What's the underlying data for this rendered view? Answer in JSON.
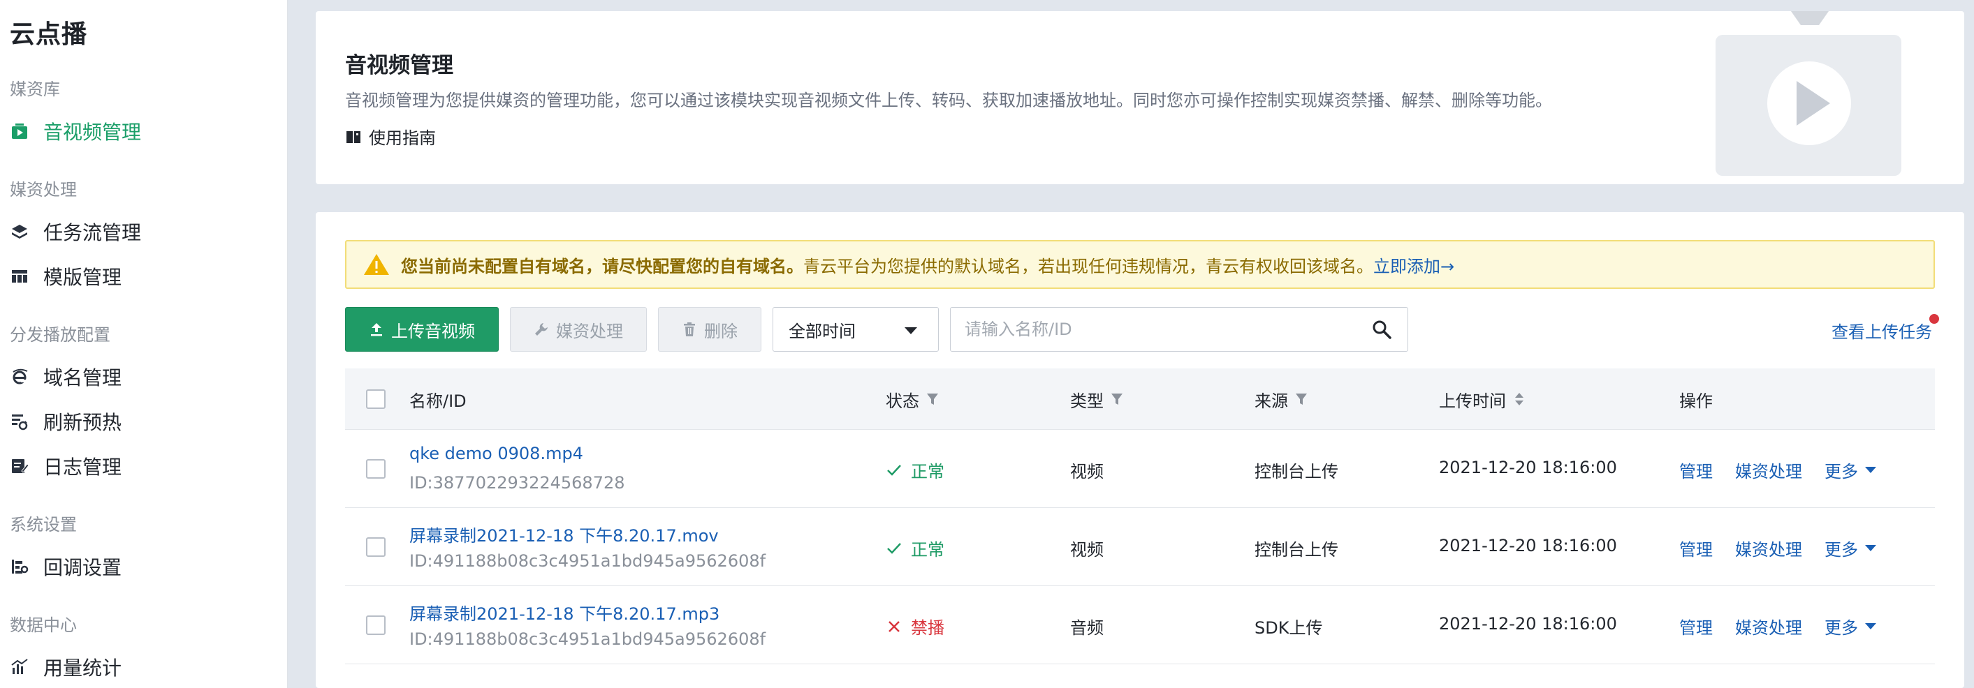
{
  "sidebar": {
    "app_title": "云点播",
    "groups": [
      {
        "label": "媒资库"
      },
      {
        "label": "媒资处理"
      },
      {
        "label": "分发播放配置"
      },
      {
        "label": "系统设置"
      },
      {
        "label": "数据中心"
      }
    ],
    "items": [
      {
        "label": "音视频管理",
        "icon": "media-library-icon",
        "active": true
      },
      {
        "label": "任务流管理",
        "icon": "layers-icon"
      },
      {
        "label": "模版管理",
        "icon": "template-grid-icon"
      },
      {
        "label": "域名管理",
        "icon": "domain-e-icon"
      },
      {
        "label": "刷新预热",
        "icon": "refresh-list-icon"
      },
      {
        "label": "日志管理",
        "icon": "log-edit-icon"
      },
      {
        "label": "回调设置",
        "icon": "callback-settings-icon"
      },
      {
        "label": "用量统计",
        "icon": "usage-chart-icon"
      }
    ]
  },
  "intro": {
    "title": "音视频管理",
    "description": "音视频管理为您提供媒资的管理功能，您可以通过该模块实现音视频文件上传、转码、获取加速播放地址。同时您亦可操作控制实现媒资禁播、解禁、删除等功能。",
    "guide_label": "使用指南",
    "illustration_icon": "video-play-illustration-icon"
  },
  "alert": {
    "strong_text": "您当前尚未配置自有域名，请尽快配置您的自有域名。",
    "text": "青云平台为您提供的默认域名，若出现任何违规情况，青云有权收回该域名。",
    "link_text": "立即添加→",
    "icon": "warning-triangle-icon"
  },
  "toolbar": {
    "upload_label": "上传音视频",
    "media_process_label": "媒资处理",
    "delete_label": "删除",
    "time_filter_value": "全部时间",
    "search_placeholder": "请输入名称/ID",
    "upload_tasks_label": "查看上传任务"
  },
  "table": {
    "headers": {
      "name": "名称/ID",
      "status": "状态",
      "type": "类型",
      "source": "来源",
      "upload_time": "上传时间",
      "actions": "操作"
    },
    "rows": [
      {
        "name": "qke demo 0908.mp4",
        "id": "ID:387702293224568728",
        "status": "正常",
        "status_kind": "ok",
        "type": "视频",
        "source": "控制台上传",
        "upload_time": "2021-12-20 18:16:00",
        "action_manage": "管理",
        "action_media": "媒资处理",
        "action_more": "更多"
      },
      {
        "name": "屏幕录制2021-12-18 下午8.20.17.mov",
        "id": "ID:491188b08c3c4951a1bd945a9562608f",
        "status": "正常",
        "status_kind": "ok",
        "type": "视频",
        "source": "控制台上传",
        "upload_time": "2021-12-20 18:16:00",
        "action_manage": "管理",
        "action_media": "媒资处理",
        "action_more": "更多"
      },
      {
        "name": "屏幕录制2021-12-18 下午8.20.17.mp3",
        "id": "ID:491188b08c3c4951a1bd945a9562608f",
        "status": "禁播",
        "status_kind": "bad",
        "type": "音频",
        "source": "SDK上传",
        "upload_time": "2021-12-20 18:16:00",
        "action_manage": "管理",
        "action_media": "媒资处理",
        "action_more": "更多"
      }
    ]
  },
  "colors": {
    "brand_green": "#1f9b66",
    "link_blue": "#1a5fb4",
    "danger_red": "#d9363e",
    "warning_bg": "#fdf9dc"
  }
}
